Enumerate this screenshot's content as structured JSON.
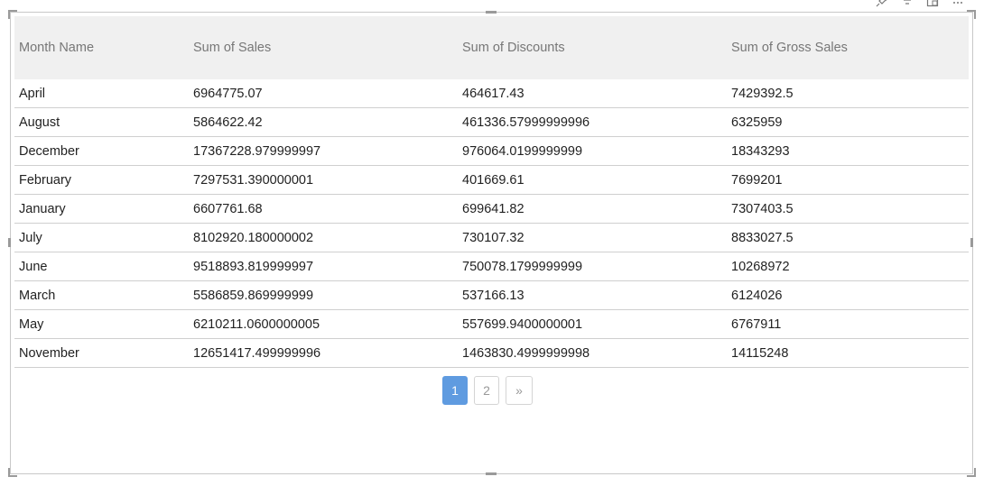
{
  "table": {
    "columns": [
      "Month Name",
      "Sum of Sales",
      "Sum of Discounts",
      "Sum of Gross Sales"
    ],
    "rows": [
      [
        "April",
        "6964775.07",
        "464617.43",
        "7429392.5"
      ],
      [
        "August",
        "5864622.42",
        "461336.57999999996",
        "6325959"
      ],
      [
        "December",
        "17367228.979999997",
        "976064.0199999999",
        "18343293"
      ],
      [
        "February",
        "7297531.390000001",
        "401669.61",
        "7699201"
      ],
      [
        "January",
        "6607761.68",
        "699641.82",
        "7307403.5"
      ],
      [
        "July",
        "8102920.180000002",
        "730107.32",
        "8833027.5"
      ],
      [
        "June",
        "9518893.819999997",
        "750078.1799999999",
        "10268972"
      ],
      [
        "March",
        "5586859.869999999",
        "537166.13",
        "6124026"
      ],
      [
        "May",
        "6210211.0600000005",
        "557699.9400000001",
        "6767911"
      ],
      [
        "November",
        "12651417.499999996",
        "1463830.4999999998",
        "14115248"
      ]
    ]
  },
  "pagination": {
    "pages": [
      "1",
      "2"
    ],
    "next_label": "»",
    "current": "1"
  },
  "colors": {
    "accent": "#5f9be0",
    "header_bg": "#f0f0f0"
  },
  "toolbar_icons": [
    "pin-icon",
    "filter-icon",
    "focus-mode-icon",
    "more-options-icon"
  ]
}
